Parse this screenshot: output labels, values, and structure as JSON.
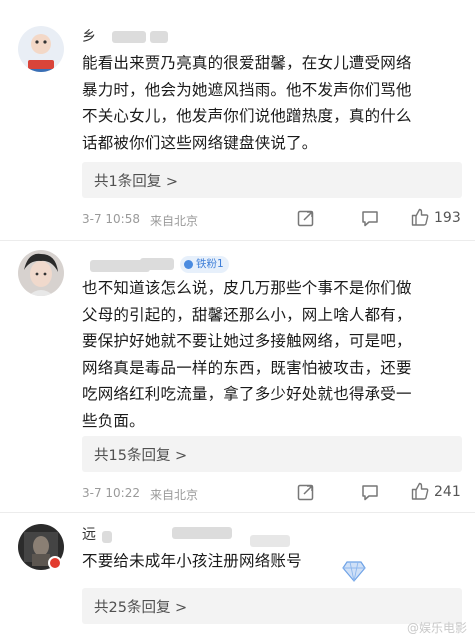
{
  "comments": [
    {
      "username": "乡",
      "lines": [
        "能看出来贾乃亮真的很爱甜馨，在女儿遭受网络",
        "暴力时，他会为她遮风挡雨。他不发声你们骂他",
        "不关心女儿，他发声你们说他蹭热度，真的什么",
        "话都被你们这些网络键盘侠说了。"
      ],
      "reply_label": "共1条回复 >",
      "time": "3-7 10:58",
      "location": "来自北京",
      "likes": "193"
    },
    {
      "username": "",
      "badge": "铁粉1",
      "lines": [
        "也不知道该怎么说，皮几万那些个事不是你们做",
        "父母的引起的，甜馨还那么小，网上啥人都有，",
        "要保护好她就不要让她过多接触网络，可是吧，",
        "网络真是毒品一样的东西，既害怕被攻击，还要",
        "吃网络红利吃流量，拿了多少好处就也得承受一",
        "些负面。"
      ],
      "reply_label": "共15条回复 >",
      "time": "3-7 10:22",
      "location": "来自北京",
      "likes": "241"
    },
    {
      "username": "远",
      "lines": [
        "不要给未成年小孩注册网络账号"
      ],
      "reply_label": "共25条回复 >"
    }
  ],
  "icons": [
    "share-icon",
    "comment-icon",
    "like-icon"
  ],
  "watermark": "@娱乐电影"
}
